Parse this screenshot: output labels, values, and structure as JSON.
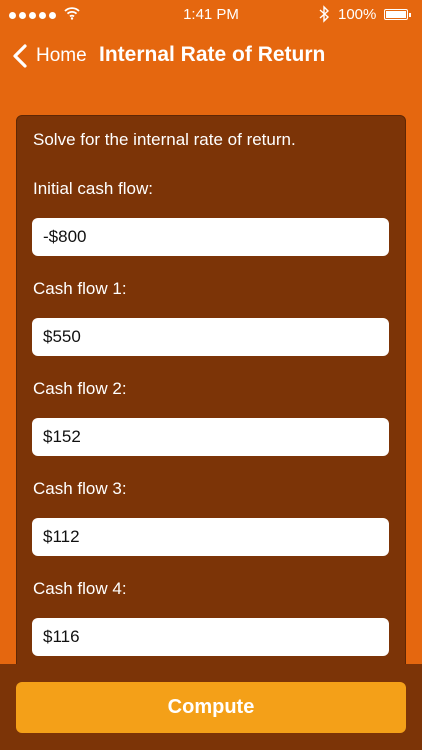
{
  "status_bar": {
    "time": "1:41 PM",
    "battery": "100%",
    "icons": [
      "signal-dots-icon",
      "wifi-icon",
      "bluetooth-icon",
      "battery-icon"
    ]
  },
  "nav": {
    "back_label": "Home",
    "title": "Internal Rate of Return"
  },
  "form": {
    "intro": "Solve for the internal rate of return.",
    "fields": [
      {
        "label": "Initial cash flow:",
        "value": "-$800"
      },
      {
        "label": "Cash flow 1:",
        "value": "$550"
      },
      {
        "label": "Cash flow 2:",
        "value": "$152"
      },
      {
        "label": "Cash flow 3:",
        "value": "$112"
      },
      {
        "label": "Cash flow 4:",
        "value": "$116"
      }
    ]
  },
  "actions": {
    "compute_label": "Compute"
  },
  "colors": {
    "background": "#e5670f",
    "card": "#7c3407",
    "button": "#f4a018"
  }
}
